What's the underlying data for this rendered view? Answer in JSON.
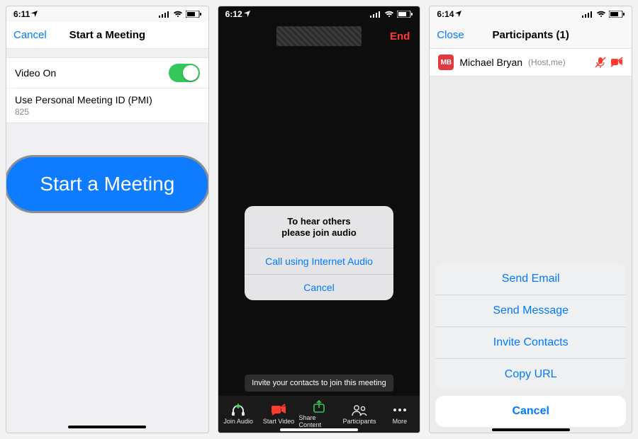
{
  "screen1": {
    "time": "6:11",
    "nav_cancel": "Cancel",
    "nav_title": "Start a Meeting",
    "rows": {
      "video_on": "Video On",
      "pmi_label": "Use Personal Meeting ID (PMI)",
      "pmi_sub": "825"
    },
    "big_button": "Start a Meeting"
  },
  "screen2": {
    "time": "6:12",
    "end": "End",
    "alert": {
      "line1": "To hear others",
      "line2": "please join audio",
      "primary": "Call using Internet Audio",
      "cancel": "Cancel"
    },
    "toast": "Invite your contacts to join this meeting",
    "bar": {
      "join_audio": "Join Audio",
      "start_video": "Start Video",
      "share_content": "Share Content",
      "participants": "Participants",
      "more": "More"
    }
  },
  "screen3": {
    "time": "6:14",
    "nav_close": "Close",
    "nav_title": "Participants (1)",
    "participant": {
      "initials": "MB",
      "name": "Michael Bryan",
      "suffix": "(Host,me)"
    },
    "sheet": {
      "email": "Send Email",
      "message": "Send Message",
      "contacts": "Invite Contacts",
      "copy": "Copy URL",
      "cancel": "Cancel"
    }
  }
}
